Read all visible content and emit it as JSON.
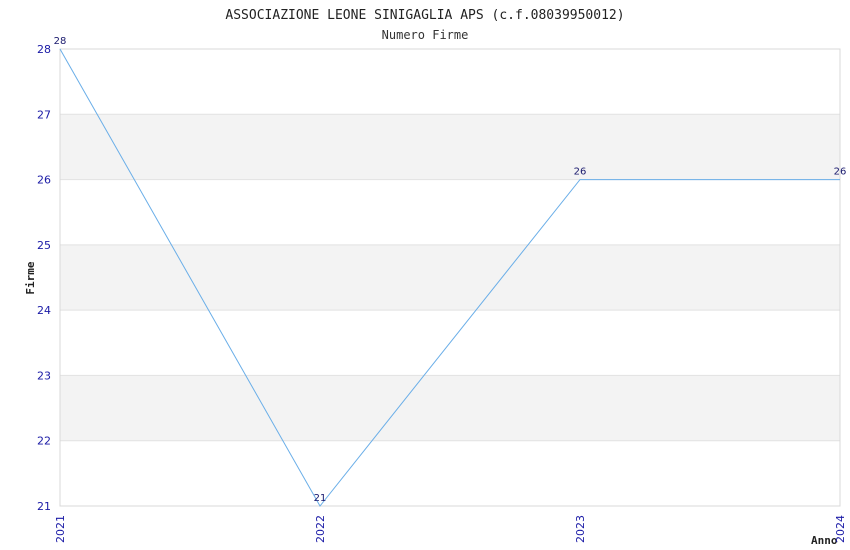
{
  "chart_data": {
    "type": "line",
    "title": "ASSOCIAZIONE LEONE SINIGAGLIA APS (c.f.08039950012)",
    "subtitle": "Numero Firme",
    "xlabel": "Anno",
    "ylabel": "Firme",
    "categories": [
      "2021",
      "2022",
      "2023",
      "2024"
    ],
    "series": [
      {
        "values": [
          28,
          21,
          26,
          26
        ]
      }
    ],
    "ylim": [
      21,
      28
    ],
    "yticks": [
      21,
      22,
      23,
      24,
      25,
      26,
      27,
      28
    ],
    "grid": true,
    "colors": {
      "line": "#6aaee8",
      "tick_text": "#1a1aa6",
      "data_label": "#1a1a6e",
      "band": "#f3f3f3",
      "gridline": "#e2e2e2",
      "frame": "#d8d8d8"
    }
  }
}
